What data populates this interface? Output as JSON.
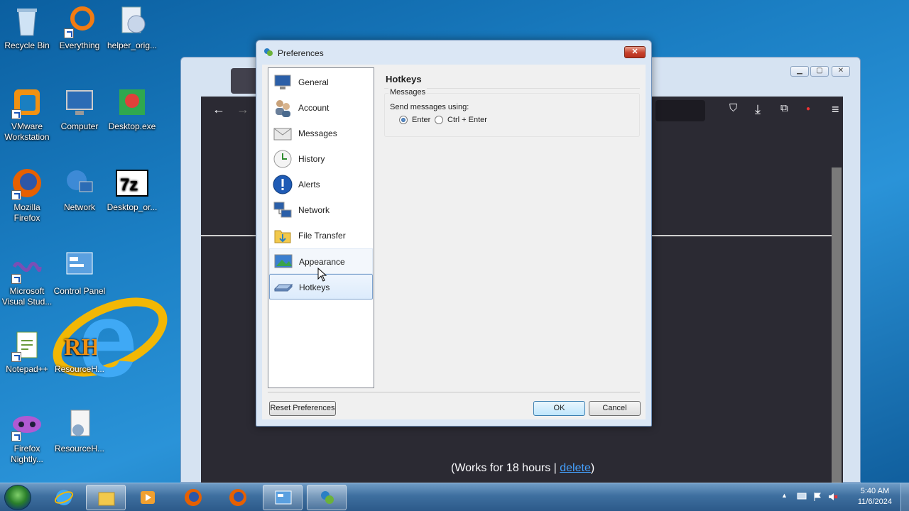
{
  "desktop": {
    "icons": [
      {
        "label": "Recycle Bin"
      },
      {
        "label": "Everything"
      },
      {
        "label": "helper_orig..."
      },
      {
        "label": "VMware Workstation"
      },
      {
        "label": "Computer"
      },
      {
        "label": "Desktop.exe"
      },
      {
        "label": "Mozilla Firefox"
      },
      {
        "label": "Network"
      },
      {
        "label": "Desktop_or..."
      },
      {
        "label": "Microsoft Visual Stud..."
      },
      {
        "label": "Control Panel"
      },
      {
        "label": "Notepad++"
      },
      {
        "label": "ResourceH..."
      },
      {
        "label": "Firefox Nightly..."
      },
      {
        "label": "ResourceH..."
      }
    ]
  },
  "browser": {
    "works_text": "(Works for 18 hours | ",
    "delete_link": "delete",
    "works_close": ")"
  },
  "dialog": {
    "title": "Preferences",
    "close": "✕",
    "nav": [
      {
        "label": "General",
        "icon": "monitor-icon"
      },
      {
        "label": "Account",
        "icon": "users-icon"
      },
      {
        "label": "Messages",
        "icon": "envelope-icon"
      },
      {
        "label": "History",
        "icon": "clock-icon"
      },
      {
        "label": "Alerts",
        "icon": "alert-icon"
      },
      {
        "label": "Network",
        "icon": "network-icon"
      },
      {
        "label": "File Transfer",
        "icon": "folder-icon"
      },
      {
        "label": "Appearance",
        "icon": "appearance-icon"
      },
      {
        "label": "Hotkeys",
        "icon": "keyboard-icon"
      }
    ],
    "selected": "Hotkeys",
    "panel": {
      "title": "Hotkeys",
      "group_title": "Messages",
      "send_label": "Send messages using:",
      "option_enter": "Enter",
      "option_ctrl_enter": "Ctrl + Enter",
      "selected_option": "Enter"
    },
    "buttons": {
      "reset": "Reset Preferences",
      "ok": "OK",
      "cancel": "Cancel"
    }
  },
  "taskbar": {
    "time": "5:40 AM",
    "date": "11/6/2024"
  }
}
